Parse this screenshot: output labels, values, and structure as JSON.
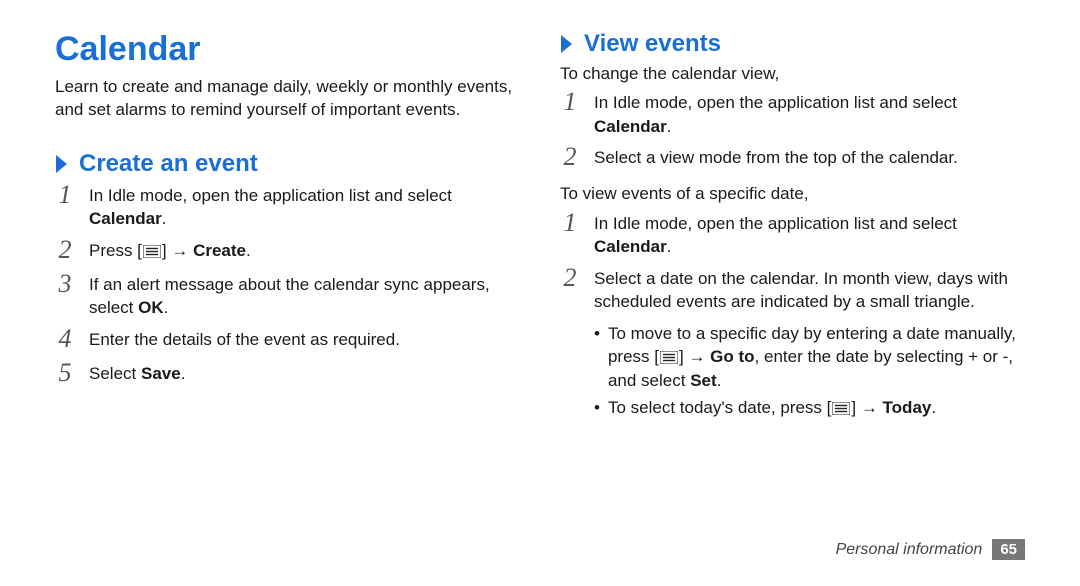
{
  "header": {
    "title": "Calendar"
  },
  "left": {
    "intro": "Learn to create and manage daily, weekly or monthly events, and set alarms to remind yourself of important events.",
    "h2": "Create an event",
    "steps": [
      {
        "n": "1",
        "pre": "In Idle mode, open the application list and select ",
        "bold": "Calendar",
        "post": "."
      },
      {
        "n": "2",
        "pre": "Press [",
        "icon": "menu",
        "mid": "] → ",
        "bold": "Create",
        "post": "."
      },
      {
        "n": "3",
        "pre": "If an alert message about the calendar sync appears, select ",
        "bold": "OK",
        "post": "."
      },
      {
        "n": "4",
        "pre": "Enter the details of the event as required.",
        "bold": "",
        "post": ""
      },
      {
        "n": "5",
        "pre": "Select ",
        "bold": "Save",
        "post": "."
      }
    ]
  },
  "right": {
    "h2": "View events",
    "introA": "To change the calendar view,",
    "stepsA": [
      {
        "n": "1",
        "pre": "In Idle mode, open the application list and select ",
        "bold": "Calendar",
        "post": "."
      },
      {
        "n": "2",
        "pre": "Select a view mode from the top of the calendar.",
        "bold": "",
        "post": ""
      }
    ],
    "introB": "To view events of a specific date,",
    "stepsB": [
      {
        "n": "1",
        "pre": "In Idle mode, open the application list and select ",
        "bold": "Calendar",
        "post": "."
      },
      {
        "n": "2",
        "pre": "Select a date on the calendar. In month view, days with scheduled events are indicated by a small triangle.",
        "bold": "",
        "post": ""
      }
    ],
    "bullets": [
      {
        "pre": "To move to a specific day by entering a date manually, press [",
        "icon": "menu",
        "mid": "] → ",
        "bold": "Go to",
        "post": ", enter the date by selecting + or -, and select ",
        "bold2": "Set",
        "post2": "."
      },
      {
        "pre": "To select today's date, press [",
        "icon": "menu",
        "mid": "] → ",
        "bold": "Today",
        "post": "."
      }
    ]
  },
  "footer": {
    "label": "Personal information",
    "page": "65"
  }
}
